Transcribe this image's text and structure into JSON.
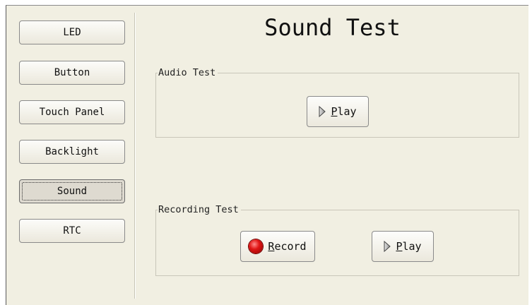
{
  "nav": {
    "items": [
      {
        "label": "LED"
      },
      {
        "label": "Button"
      },
      {
        "label": "Touch Panel"
      },
      {
        "label": "Backlight"
      },
      {
        "label": "Sound",
        "active": true
      },
      {
        "label": "RTC"
      }
    ]
  },
  "main": {
    "title": "Sound Test",
    "audio_group": {
      "label": "Audio Test",
      "play_button": {
        "mnemonic": "P",
        "rest": "lay",
        "icon": "play-icon"
      }
    },
    "recording_group": {
      "label": "Recording Test",
      "record_button": {
        "mnemonic": "R",
        "rest": "ecord",
        "icon": "record-icon"
      },
      "play_button": {
        "mnemonic": "P",
        "rest": "lay",
        "icon": "play-icon"
      }
    }
  },
  "colors": {
    "window_bg": "#f1efe2",
    "record_red": "#e01515"
  }
}
